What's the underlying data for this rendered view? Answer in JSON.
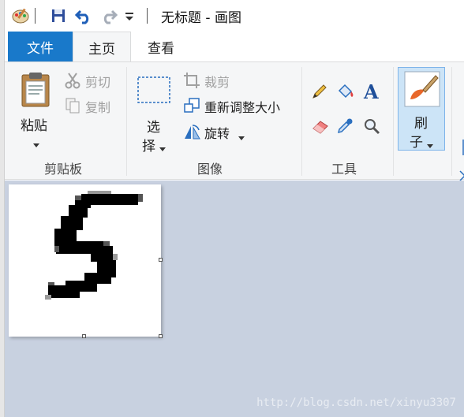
{
  "window": {
    "title": "无标题 - 画图"
  },
  "tabs": [
    {
      "label": "文件"
    },
    {
      "label": "主页"
    },
    {
      "label": "查看"
    }
  ],
  "ribbon": {
    "clipboard": {
      "group_label": "剪贴板",
      "paste": "粘贴",
      "cut": "剪切",
      "copy": "复制"
    },
    "image": {
      "group_label": "图像",
      "select_1": "选",
      "select_2": "择",
      "crop": "裁剪",
      "resize": "重新调整大小",
      "rotate": "旋转"
    },
    "tools": {
      "group_label": "工具",
      "icons": [
        "pencil-icon",
        "fill-icon",
        "text-icon",
        "eraser-icon",
        "color-picker-icon",
        "magnifier-icon"
      ]
    },
    "brushes": {
      "label_1": "刷",
      "label_2": "子"
    }
  },
  "canvas": {
    "content": "handwritten digit 5 (pixelated)"
  },
  "watermark": "http://blog.csdn.net/xinyu3307",
  "colors": {
    "file_tab": "#1979ca",
    "ribbon_bg": "#f5f6f7",
    "workspace_bg": "#c8d1e0",
    "brush_selected": "#cce4f7"
  }
}
